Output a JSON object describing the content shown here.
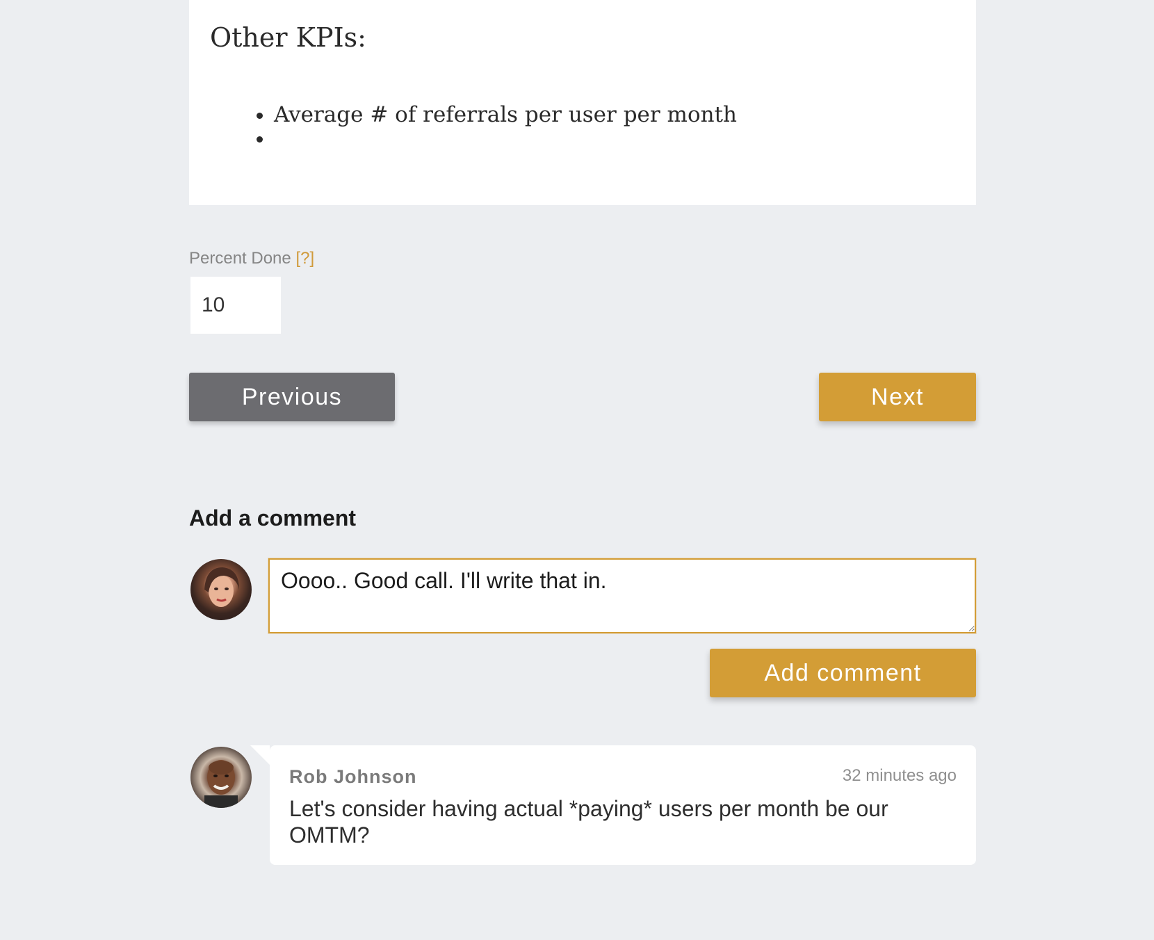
{
  "editor": {
    "heading": "Other KPIs:",
    "bullets": [
      "Average # of referrals per user per month",
      ""
    ]
  },
  "progress": {
    "label": "Percent Done",
    "help": "[?]",
    "value": "10"
  },
  "navigation": {
    "previous_label": "Previous",
    "next_label": "Next"
  },
  "new_comment": {
    "heading": "Add a comment",
    "draft": "Oooo.. Good call. I'll write that in.",
    "submit_label": "Add comment"
  },
  "comments": [
    {
      "author": "Rob Johnson",
      "time": "32 minutes ago",
      "text": "Let's consider having actual *paying* users per month be our OMTM?"
    }
  ],
  "colors": {
    "accent": "#d39d36",
    "secondary_button": "#6c6c70",
    "background": "#eceef1"
  },
  "icons": {
    "current_user": "user-avatar",
    "commenter": "user-avatar"
  }
}
